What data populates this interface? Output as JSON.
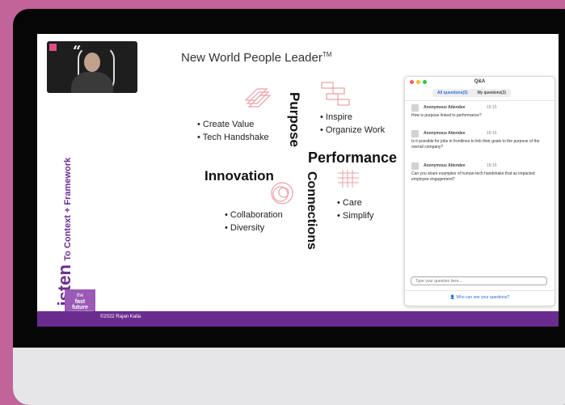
{
  "slide": {
    "title": "New World People Leader",
    "title_tm": "TM",
    "footer": "©2022 Rajan Kalia",
    "side_listen": "Listen",
    "side_context": "To Context + Framework",
    "logo_lines": [
      "the",
      "fast",
      "future",
      "accelerator"
    ],
    "words": {
      "purpose": "Purpose",
      "performance": "Performance",
      "innovation": "Innovation",
      "connections": "Connections"
    },
    "bullets_create": [
      "Create Value",
      "Tech Handshake"
    ],
    "bullets_inspire": [
      "Inspire",
      "Organize Work"
    ],
    "bullets_collab": [
      "Collaboration",
      "Diversity"
    ],
    "bullets_care": [
      "Care",
      "Simplify"
    ]
  },
  "qa": {
    "title": "Q&A",
    "tabs": [
      "All questions(3)",
      "My questions(3)"
    ],
    "questions": [
      {
        "name": "Anonymous Attendee",
        "time": "18:15",
        "text": "How is purpose linked to performance?"
      },
      {
        "name": "Anonymous Attendee",
        "time": "18:16",
        "text": "Is it possible for jobs in frontlines to link their goals to the purpose of the overall company?"
      },
      {
        "name": "Anonymous Attendee",
        "time": "18:16",
        "text": "Can you share examples of human-tech handshake that as impacted employee engagement?"
      }
    ],
    "input_placeholder": "Type your question here...",
    "footer_link": "Who can see your questions?"
  },
  "colors": {
    "brand_purple": "#6a2d8f",
    "accent_pink": "#c0649a",
    "link_blue": "#2b6cd8"
  }
}
